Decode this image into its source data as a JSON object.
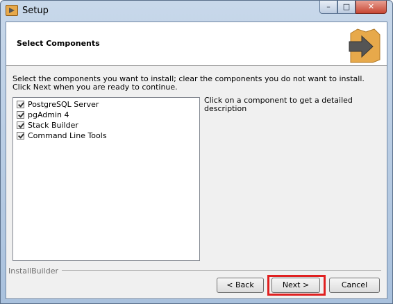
{
  "window": {
    "title": "Setup",
    "icons": {
      "app": "installer-arrow-icon",
      "minimize": "minimize-icon",
      "maximize": "maximize-icon",
      "close": "close-icon"
    },
    "minimize_glyph": "–",
    "maximize_glyph": "□",
    "close_glyph": "✕"
  },
  "header": {
    "title": "Select Components",
    "logo_icon": "box-arrow-logo-icon",
    "logo_colors": {
      "box": "#e7a94b",
      "arrow": "#555555"
    }
  },
  "instructions": "Select the components you want to install; clear the components you do not want to install. Click Next when you are ready to continue.",
  "components": [
    {
      "label": "PostgreSQL Server",
      "checked": true
    },
    {
      "label": "pgAdmin 4",
      "checked": true
    },
    {
      "label": "Stack Builder",
      "checked": true
    },
    {
      "label": "Command Line Tools",
      "checked": true
    }
  ],
  "description": "Click on a component to get a detailed description",
  "footer": {
    "brand": "InstallBuilder",
    "back_label": "< Back",
    "next_label": "Next >",
    "cancel_label": "Cancel",
    "highlight_color": "#e02020"
  }
}
